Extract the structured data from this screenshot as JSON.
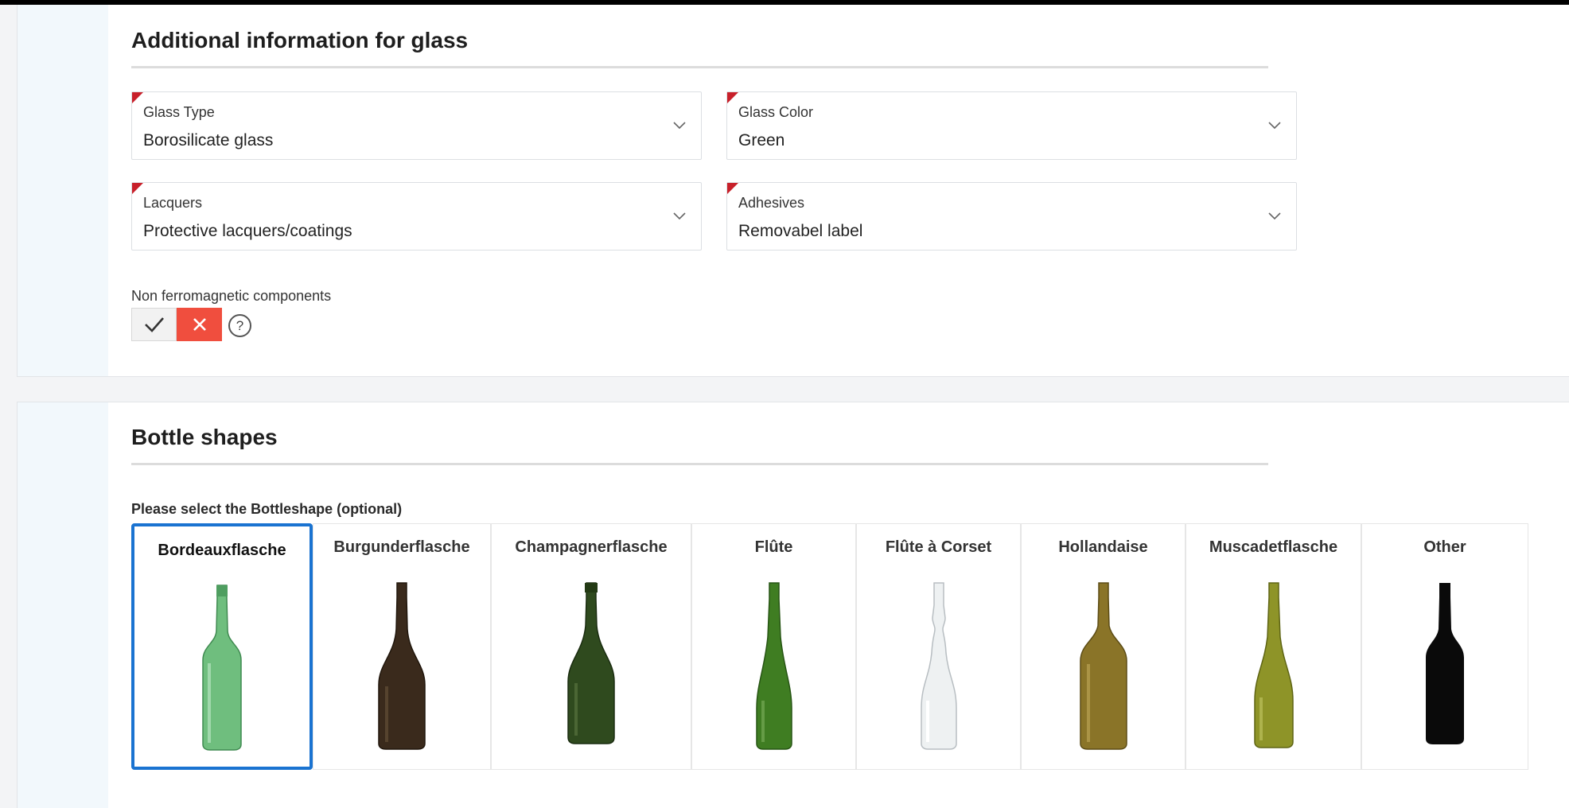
{
  "glass_section": {
    "title": "Additional information for glass",
    "fields": {
      "glass_type": {
        "label": "Glass Type",
        "value": "Borosilicate glass"
      },
      "glass_color": {
        "label": "Glass Color",
        "value": "Green"
      },
      "lacquers": {
        "label": "Lacquers",
        "value": "Protective lacquers/coatings"
      },
      "adhesives": {
        "label": "Adhesives",
        "value": "Removabel label"
      }
    },
    "non_ferromagnetic": {
      "label": "Non ferromagnetic components",
      "selected": "no",
      "help_glyph": "?"
    }
  },
  "shapes_section": {
    "title": "Bottle shapes",
    "prompt": "Please select the Bottleshape (optional)",
    "selected": "Bordeauxflasche",
    "shapes": [
      {
        "label": "Bordeauxflasche",
        "color": "#6fbe7e"
      },
      {
        "label": "Burgunderflasche",
        "color": "#3a2a1c"
      },
      {
        "label": "Champagnerflasche",
        "color": "#2f4a1e"
      },
      {
        "label": "Flûte",
        "color": "#3f7d22"
      },
      {
        "label": "Flûte à Corset",
        "color": "#e4e8ea"
      },
      {
        "label": "Hollandaise",
        "color": "#8a7428"
      },
      {
        "label": "Muscadetflasche",
        "color": "#8e9428"
      },
      {
        "label": "Other",
        "color": "#0a0a0a"
      }
    ]
  },
  "colors": {
    "accent_selected": "#1a73d1",
    "required_marker": "#c8202a",
    "toggle_no_active": "#f04e3e"
  },
  "icons": {
    "dropdown": "chevron-down-icon",
    "yes": "check-icon",
    "no": "close-icon",
    "help": "question-circle-icon"
  }
}
